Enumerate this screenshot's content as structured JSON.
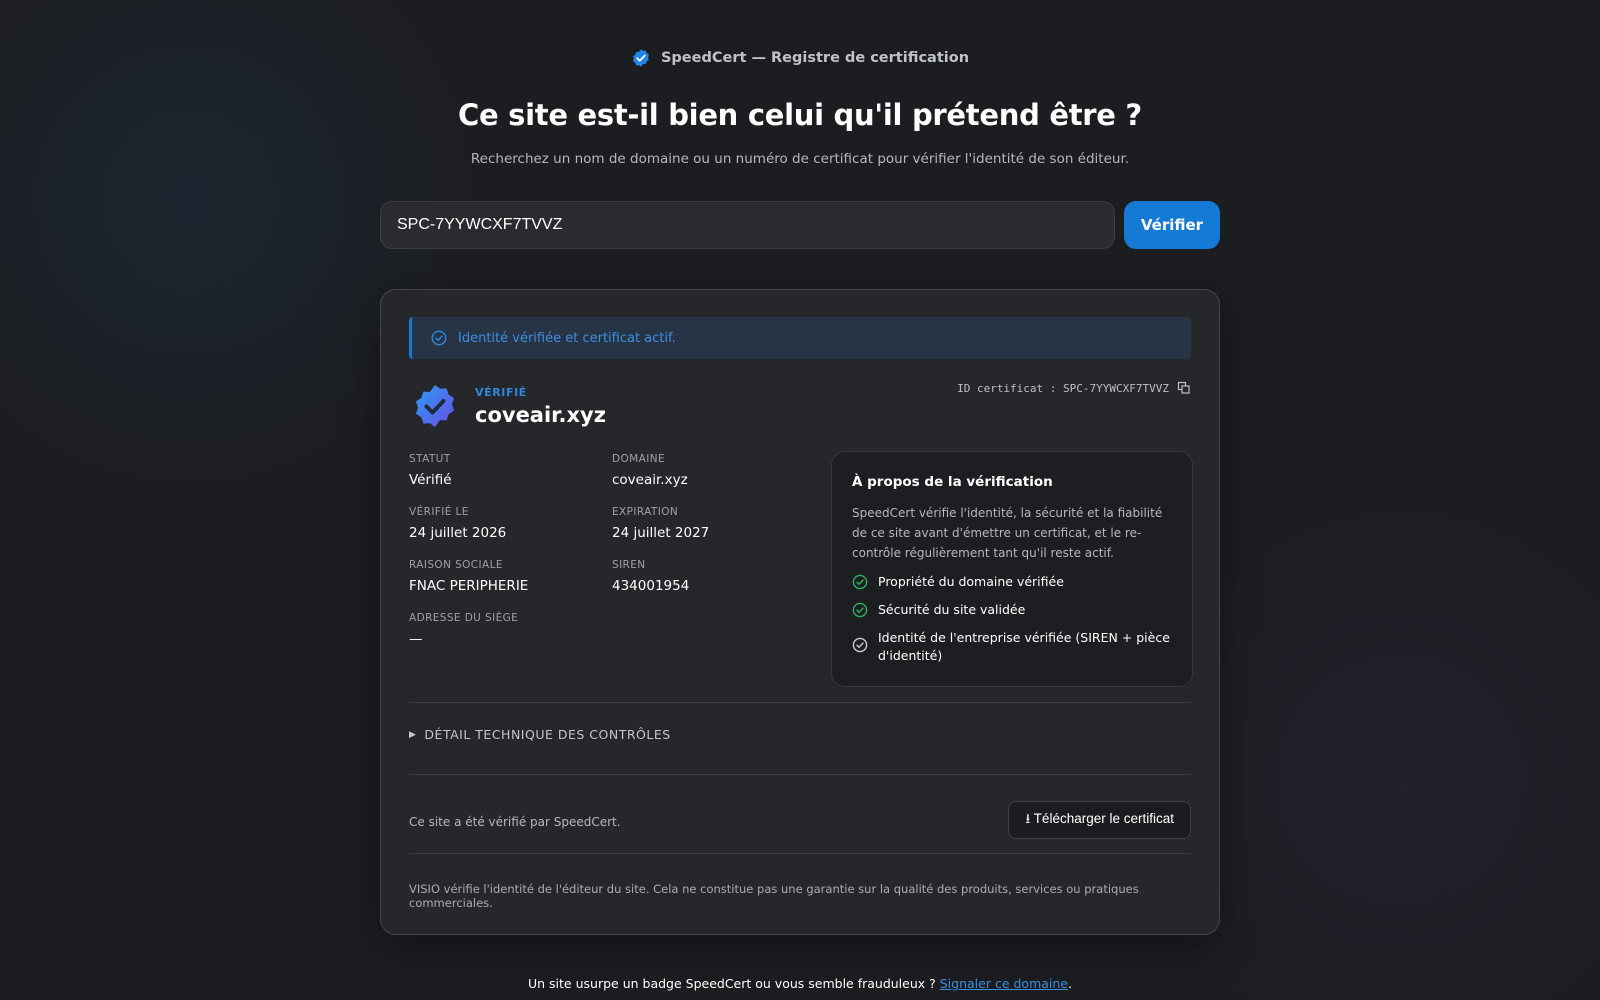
{
  "brand": {
    "name": "SpeedCert — Registre de certification",
    "icon": "verified-badge-icon"
  },
  "hero": {
    "title": "Ce site est-il bien celui qu'il prétend être ?",
    "subtitle": "Recherchez un nom de domaine ou un numéro de certificat pour vérifier l'identité de son éditeur."
  },
  "search": {
    "value": "SPC-7YYWCXF7TVVZ",
    "button_label": "Vérifier"
  },
  "result": {
    "banner": "Identité vérifiée et certificat actif.",
    "status_label": "VÉRIFIÉ",
    "domain": "coveair.xyz",
    "cert_id_label": "ID certificat : SPC-7YYWCXF7TVVZ",
    "fields": {
      "statut": {
        "label": "STATUT",
        "value": "Vérifié"
      },
      "domaine": {
        "label": "DOMAINE",
        "value": "coveair.xyz"
      },
      "verifie_le": {
        "label": "VÉRIFIÉ LE",
        "value": "24 juillet 2026"
      },
      "expiration": {
        "label": "EXPIRATION",
        "value": "24 juillet 2027"
      },
      "raison_sociale": {
        "label": "RAISON SOCIALE",
        "value": "FNAC PERIPHERIE"
      },
      "siren": {
        "label": "SIREN",
        "value": "434001954"
      },
      "adresse": {
        "label": "ADRESSE DU SIÈGE",
        "value": "—"
      }
    },
    "about": {
      "title": "À propos de la vérification",
      "text": "SpeedCert vérifie l'identité, la sécurité et la fiabilité de ce site avant d'émettre un certificat, et le re-contrôle régulièrement tant qu'il reste actif.",
      "checks": [
        "Propriété du domaine vérifiée",
        "Sécurité du site validée",
        "Identité de l'entreprise vérifiée (SIREN + pièce d'identité)"
      ]
    },
    "tech_details": "DÉTAIL TECHNIQUE DES CONTRÔLES",
    "verified_by": "Ce site a été vérifié par SpeedCert.",
    "download_label": "⭳ Télécharger le certificat",
    "disclaimer": "VISIO vérifie l'identité de l'éditeur du site. Cela ne constitue pas une garantie sur la qualité des produits, services ou pratiques commerciales."
  },
  "footer": {
    "text": "Un site usurpe un badge SpeedCert ou vous semble frauduleux ? ",
    "link": "Signaler ce domaine",
    "end": "."
  },
  "colors": {
    "accent": "#1579d6",
    "success": "#2fb35f",
    "background": "#1c1d20",
    "card": "#26272b"
  }
}
